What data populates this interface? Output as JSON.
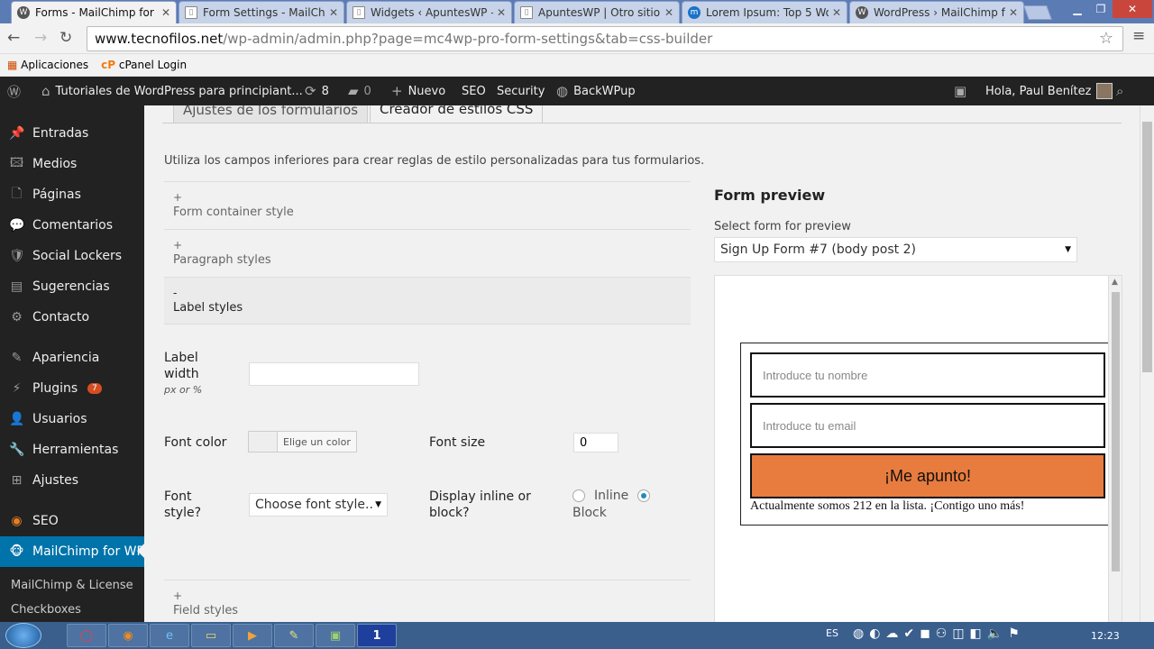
{
  "tabs": [
    {
      "title": "Forms - MailChimp for W",
      "icon": "W"
    },
    {
      "title": "Form Settings - MailChim",
      "icon": "▯"
    },
    {
      "title": "Widgets ‹ ApuntesWP —",
      "icon": "▯"
    },
    {
      "title": "ApuntesWP | Otro sitio re",
      "icon": "▯"
    },
    {
      "title": "Lorem Ipsum: Top 5 Wor",
      "icon": "m"
    },
    {
      "title": "WordPress › MailChimp f",
      "icon": "W"
    }
  ],
  "window": {
    "minimize": "▁",
    "restore": "❐",
    "close": "✕"
  },
  "address": {
    "host": "www.tecnofilos.net",
    "path": "/wp-admin/admin.php?page=mc4wp-pro-form-settings&tab=css-builder"
  },
  "bookmarks": {
    "apps": "Aplicaciones",
    "cpanel": "cPanel Login"
  },
  "adminbar": {
    "site": "Tutoriales de WordPress para principiant...",
    "updates": "8",
    "comments": "0",
    "new": "Nuevo",
    "seo": "SEO",
    "security": "Security",
    "backup": "BackWPup",
    "greeting": "Hola, Paul Benítez"
  },
  "sidebar": {
    "items": [
      {
        "label": "Entradas",
        "icon": "📌"
      },
      {
        "label": "Medios",
        "icon": "🖾"
      },
      {
        "label": "Páginas",
        "icon": "🗋"
      },
      {
        "label": "Comentarios",
        "icon": "💬"
      },
      {
        "label": "Social Lockers",
        "icon": "🛡"
      },
      {
        "label": "Sugerencias",
        "icon": "▤"
      },
      {
        "label": "Contacto",
        "icon": "⚙"
      },
      {
        "label": "Apariencia",
        "icon": "✎"
      },
      {
        "label": "Plugins",
        "icon": "⚡"
      },
      {
        "label": "Usuarios",
        "icon": "👤"
      },
      {
        "label": "Herramientas",
        "icon": "🔧"
      },
      {
        "label": "Ajustes",
        "icon": "⊞"
      },
      {
        "label": "SEO",
        "icon": "◉"
      },
      {
        "label": "MailChimp for WP",
        "icon": "🐵"
      }
    ],
    "plugins_badge": "7",
    "submenu": [
      "MailChimp & License",
      "Checkboxes"
    ]
  },
  "content": {
    "tab_settings": "Ajustes de los formularios",
    "tab_css": "Creador de estilos CSS",
    "description": "Utiliza los campos inferiores para crear reglas de estilo personalizadas para tus formularios.",
    "sections": [
      {
        "sign": "+",
        "label": "Form container style"
      },
      {
        "sign": "+",
        "label": "Paragraph styles"
      },
      {
        "sign": "-",
        "label": "Label styles"
      },
      {
        "sign": "+",
        "label": "Field styles"
      }
    ],
    "label_width": {
      "line1": "Label",
      "line2": "width",
      "hint": "px or %",
      "value": ""
    },
    "font_color": {
      "label": "Font color",
      "button": "Elige un color"
    },
    "font_size": {
      "label": "Font size",
      "value": "0"
    },
    "font_style": {
      "line1": "Font",
      "line2": "style?",
      "selected": "Choose font style..",
      "caret": "▼"
    },
    "display": {
      "line1": "Display inline or",
      "line2": "block?",
      "inline": "Inline",
      "block": "Block",
      "selected": "block"
    }
  },
  "preview": {
    "heading": "Form preview",
    "select_label": "Select form for preview",
    "selected_form": "Sign Up Form #7 (body post 2)",
    "caret": "▼",
    "name_placeholder": "Introduce tu nombre",
    "email_placeholder": "Introduce tu email",
    "submit": "¡Me apunto!",
    "message": "Actualmente somos 212 en la lista. ¡Contigo uno más!"
  },
  "taskbar": {
    "lang": "ES",
    "time": "12:23",
    "apps": [
      "◯",
      "◉",
      "e",
      "▭",
      "▶",
      "✎",
      "▣",
      "1"
    ]
  }
}
